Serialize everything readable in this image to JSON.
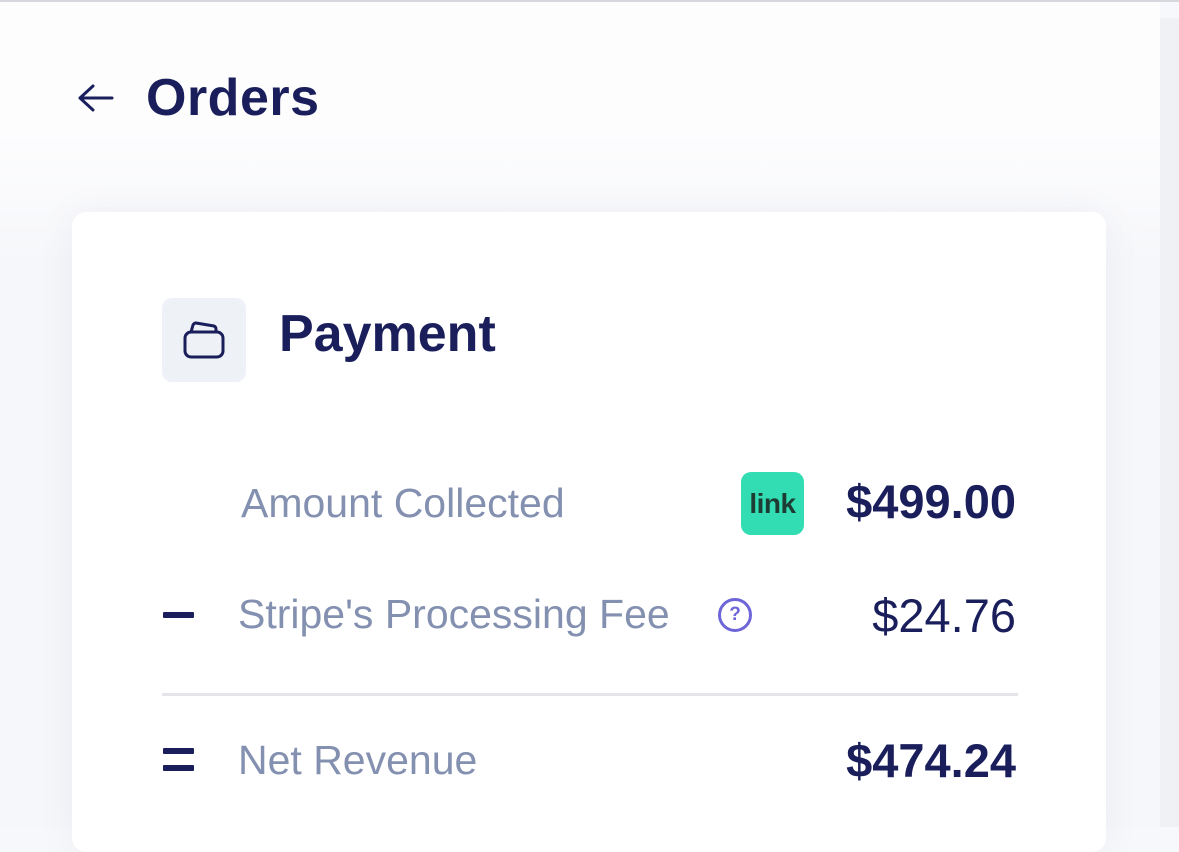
{
  "header": {
    "back_icon": "arrow-left-icon",
    "title": "Orders"
  },
  "payment": {
    "icon": "wallet-icon",
    "title": "Payment",
    "amount_collected": {
      "label": "Amount Collected",
      "badge": "link",
      "badge_color": "#33ddb3",
      "value": "$499.00"
    },
    "processing_fee": {
      "operator_icon": "minus-icon",
      "label": "Stripe's Processing Fee",
      "help_icon": "question-circle-icon",
      "help_glyph": "?",
      "value": "$24.76"
    },
    "net_revenue": {
      "operator_icon": "equals-icon",
      "label": "Net Revenue",
      "value": "$474.24"
    }
  },
  "colors": {
    "primary_text": "#1a1f5c",
    "muted_text": "#8390b0",
    "accent": "#6e66d8"
  }
}
